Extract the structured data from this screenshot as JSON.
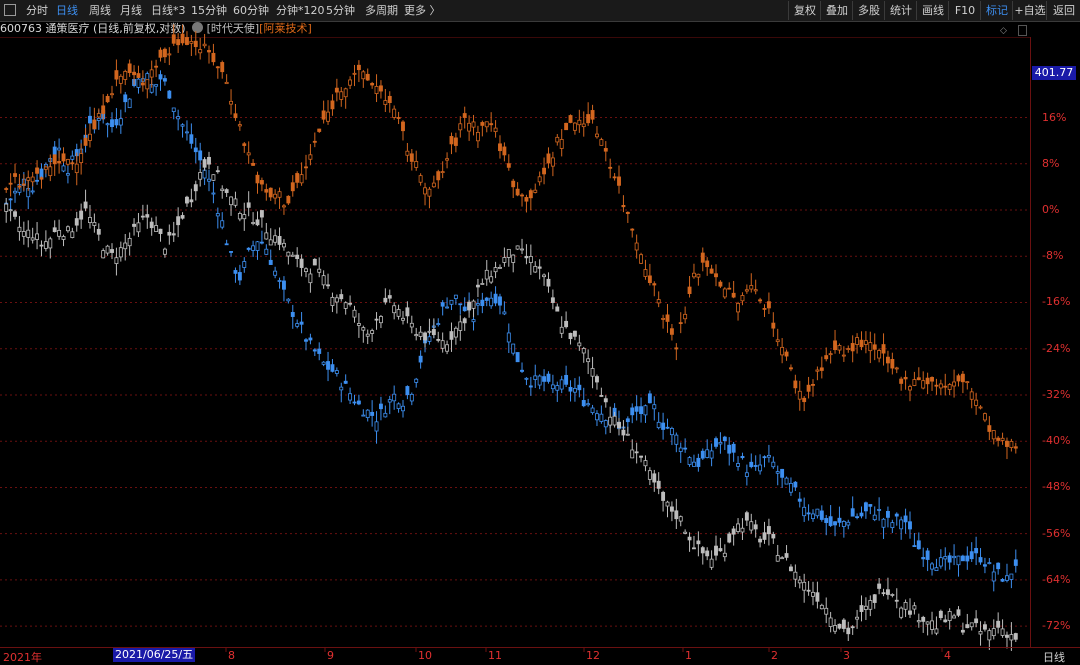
{
  "toolbar": {
    "left_items": [
      {
        "label": "分时",
        "active": false
      },
      {
        "label": "日线",
        "active": true
      },
      {
        "label": "周线",
        "active": false
      },
      {
        "label": "月线",
        "active": false
      },
      {
        "label": "日线*3",
        "active": false
      },
      {
        "label": "15分钟",
        "active": false
      },
      {
        "label": "60分钟",
        "active": false
      },
      {
        "label": "分钟*120",
        "active": false
      },
      {
        "label": "5分钟",
        "active": false
      },
      {
        "label": "多周期",
        "active": false
      },
      {
        "label": "更多 〉",
        "active": false
      }
    ],
    "right_items": [
      {
        "label": "复权",
        "active": false
      },
      {
        "label": "叠加",
        "active": false
      },
      {
        "label": "多股",
        "active": false
      },
      {
        "label": "统计",
        "active": false
      },
      {
        "label": "画线",
        "active": false
      },
      {
        "label": "F10",
        "active": false
      },
      {
        "label": "标记",
        "active": true
      },
      {
        "label": "+自选",
        "active": false
      },
      {
        "label": "返回",
        "active": false
      }
    ]
  },
  "info": {
    "code": "600763",
    "name": "通策医疗",
    "mode": "(日线,前复权,对数)",
    "overlay_1": "[时代天使]",
    "overlay_2": "[阿莱技术]"
  },
  "colors": {
    "background": "#000000",
    "grid": "#6a1010",
    "axis_text": "#e03030",
    "series_main": "#3d8ff0",
    "series_overlay_1": "#bdbdbd",
    "series_overlay_2": "#d2661f"
  },
  "chart_data": {
    "type": "candlestick-overlay",
    "scale": "log-percent",
    "y_axis_unit": "%",
    "price_tag": "401.77",
    "yticks": [
      16,
      8,
      0,
      -8,
      -16,
      -24,
      -32,
      -40,
      -48,
      -56,
      -64,
      -72
    ],
    "ylim": [
      -75,
      33
    ],
    "x_start_label": "2021年",
    "x_selected_label": "2021/06/25/五",
    "x_month_labels": [
      "8",
      "9",
      "10",
      "11",
      "12",
      "1",
      "2",
      "3",
      "4"
    ],
    "x_right_label": "日线",
    "grid": true,
    "series": [
      {
        "role": "main",
        "color": "#3d8ff0",
        "close": [
          1,
          3,
          5,
          4,
          6,
          9,
          11,
          7,
          9,
          12,
          15,
          17,
          14,
          16,
          19,
          22,
          24,
          21,
          23,
          20,
          16,
          13,
          10,
          7,
          3,
          -2,
          -8,
          -12,
          -8,
          -5,
          -6,
          -10,
          -14,
          -17,
          -20,
          -23,
          -25,
          -27,
          -28,
          -30,
          -32,
          -34,
          -35,
          -36,
          -34,
          -32,
          -33,
          -31,
          -26,
          -22,
          -19,
          -16,
          -15,
          -17,
          -19,
          -16,
          -15,
          -15,
          -19,
          -25,
          -28,
          -30,
          -29,
          -31,
          -30,
          -31,
          -31,
          -33,
          -34,
          -35,
          -36,
          -37,
          -37,
          -35,
          -35,
          -34,
          -37,
          -38,
          -40,
          -42,
          -44,
          -43,
          -41,
          -40,
          -42,
          -43,
          -45,
          -45,
          -43,
          -44,
          -47,
          -48,
          -50,
          -52,
          -52,
          -54,
          -55,
          -54,
          -53,
          -53,
          -52,
          -52,
          -54,
          -54,
          -53,
          -57,
          -59,
          -60,
          -61,
          -61,
          -61,
          -60,
          -60,
          -60,
          -62,
          -63,
          -64,
          -61
        ]
      },
      {
        "role": "overlay_1",
        "color": "#bdbdbd",
        "close": [
          0,
          -2,
          -4,
          -4,
          -6,
          -5,
          -3,
          -4,
          -2,
          0,
          -3,
          -6,
          -8,
          -7,
          -5,
          -3,
          -1,
          -3,
          -6,
          -5,
          -1,
          2,
          6,
          9,
          6,
          3,
          1,
          0,
          -1,
          -2,
          -4,
          -5,
          -7,
          -9,
          -10,
          -10,
          -12,
          -14,
          -15,
          -16,
          -19,
          -22,
          -19,
          -17,
          -16,
          -18,
          -20,
          -21,
          -22,
          -22,
          -23,
          -21,
          -19,
          -17,
          -13,
          -11,
          -10,
          -8,
          -7,
          -8,
          -9,
          -11,
          -15,
          -19,
          -21,
          -23,
          -25,
          -28,
          -32,
          -36,
          -38,
          -40,
          -42,
          -45,
          -48,
          -51,
          -52,
          -54,
          -57,
          -59,
          -60,
          -60,
          -58,
          -55,
          -54,
          -55,
          -57,
          -57,
          -59,
          -61,
          -63,
          -65,
          -66,
          -68,
          -70,
          -72,
          -73,
          -71,
          -69,
          -67,
          -65,
          -66,
          -68,
          -69,
          -70,
          -71,
          -72,
          -71,
          -70,
          -72,
          -72,
          -73,
          -73,
          -72,
          -73,
          -74
        ]
      },
      {
        "role": "overlay_2",
        "color": "#d2661f",
        "close": [
          3,
          5,
          4,
          6,
          5,
          8,
          7,
          9,
          8,
          11,
          13,
          16,
          20,
          22,
          24,
          23,
          22,
          24,
          26,
          27,
          29,
          30,
          29,
          28,
          27,
          25,
          22,
          17,
          12,
          8,
          4,
          2,
          3,
          1,
          4,
          6,
          10,
          14,
          17,
          20,
          22,
          24,
          23,
          22,
          21,
          19,
          16,
          12,
          8,
          6,
          3,
          5,
          9,
          12,
          16,
          15,
          14,
          16,
          12,
          8,
          4,
          2,
          3,
          5,
          8,
          12,
          14,
          15,
          16,
          15,
          13,
          9,
          5,
          0,
          -4,
          -8,
          -12,
          -16,
          -20,
          -23,
          -18,
          -12,
          -9,
          -10,
          -12,
          -14,
          -16,
          -15,
          -13,
          -15,
          -18,
          -22,
          -26,
          -30,
          -33,
          -30,
          -27,
          -25,
          -24,
          -25,
          -23,
          -23,
          -24,
          -25,
          -27,
          -28,
          -30,
          -29,
          -29,
          -30,
          -30,
          -31,
          -30,
          -29,
          -32,
          -35,
          -38,
          -40,
          -41,
          -41
        ]
      }
    ]
  }
}
